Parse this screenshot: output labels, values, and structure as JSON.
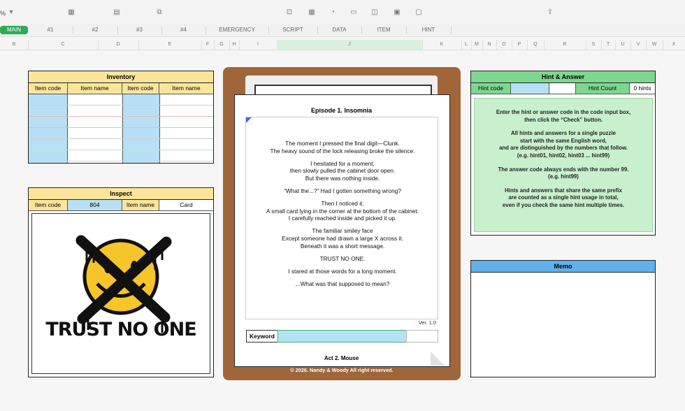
{
  "toolbar": {
    "zoom": "%"
  },
  "tabs": [
    "MAIN",
    "#1",
    "#2",
    "#3",
    "#4",
    "EMERGENCY",
    "SCRIPT",
    "DATA",
    "ITEM",
    "HINT"
  ],
  "columns": [
    "B",
    "C",
    "D",
    "E",
    "F",
    "G",
    "H",
    "I",
    "J",
    "K",
    "L",
    "M",
    "N",
    "O",
    "P",
    "Q",
    "R",
    "S",
    "T",
    "U",
    "V",
    "W",
    "X"
  ],
  "inventory": {
    "title": "Inventory",
    "col1": "Item code",
    "col2": "Item name",
    "col3": "Item code",
    "col4": "Item name"
  },
  "inspect": {
    "title": "Inspect",
    "code_label": "Item code",
    "code_value": "804",
    "name_label": "Item name",
    "name_value": "Card",
    "image_text": "TRUST NO ONE"
  },
  "episode": {
    "title": "Episode 1. Insomnia",
    "paragraphs": [
      [
        "The moment I pressed the final digit—Clunk.",
        "The heavy sound of the lock releasing broke the silence."
      ],
      [
        "I hesitated for a moment,",
        "then slowly pulled the cabinet door open.",
        "But there was nothing inside."
      ],
      [
        "“What the...?” Had I gotten something wrong?"
      ],
      [
        "Then I noticed it.",
        "A small card lying in the corner at the bottom of the cabinet.",
        "I carefully reached inside and picked it up."
      ],
      [
        "The familiar smiley face",
        "Except someone had drawn a large X across it.",
        "Beneath it was a short message."
      ],
      [
        "TRUST NO ONE."
      ],
      [
        "I stared at those words for a long moment."
      ],
      [
        "...What was that supposed to mean?"
      ]
    ],
    "version": "Ver. 1.0",
    "keyword_label": "Keyword",
    "keyword_value": "",
    "act": "Act 2. Mouse",
    "copyright": "© 2026. Nandy & Woody All right reserved."
  },
  "hint": {
    "title": "Hint & Answer",
    "code_label": "Hint code",
    "code_value": "",
    "count_label": "Hint Count",
    "count_value": "0 hints",
    "instructions": [
      [
        "Enter the hint or answer code in the code input box,",
        "then click the “Check” button."
      ],
      [
        "All hints and answers for a single puzzle",
        "start with the same English word,",
        "and are distinguished by the numbers that follow.",
        "(e.g. hint01, hint02, hint03 ... hint99)"
      ],
      [
        "The answer code always ends with the number 99.",
        "(e.g. hint99)"
      ],
      [
        "Hints and answers that share the same prefix",
        "are counted as a single hint usage in total,",
        "even if you check the same hint multiple times."
      ]
    ]
  },
  "memo": {
    "title": "Memo",
    "value": ""
  },
  "colors": {
    "yellow": "#fbe59a",
    "green": "#7dd78f",
    "blue": "#5fb1ee",
    "board": "#a0663a",
    "tab_active": "#2eaa57"
  }
}
